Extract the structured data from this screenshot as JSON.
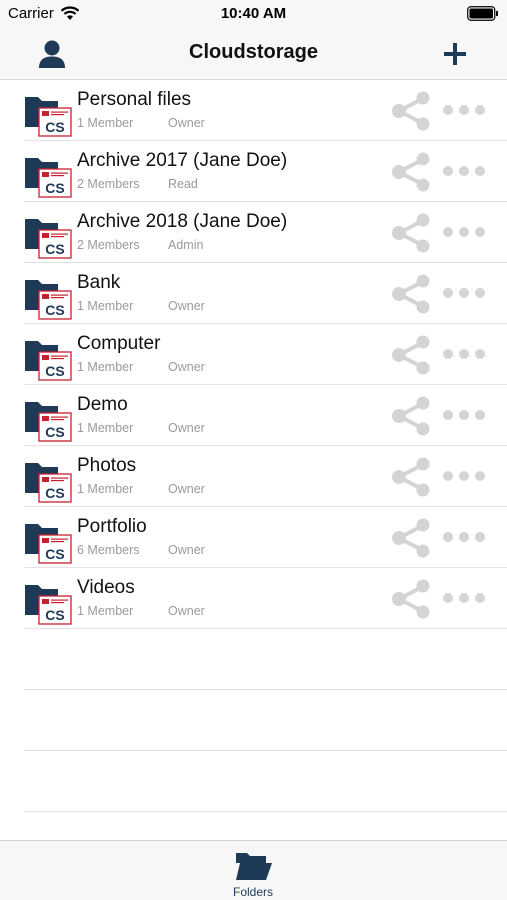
{
  "status_bar": {
    "carrier": "Carrier",
    "time": "10:40 AM"
  },
  "nav": {
    "title": "Cloudstorage",
    "left_icon": "user-icon",
    "right_icon": "plus-icon"
  },
  "colors": {
    "brand_navy": "#1e3a56",
    "badge_red": "#c8202f",
    "muted_icon": "#d4d4d4",
    "secondary_text": "#9a9a9a"
  },
  "folder_badge_text": "CS",
  "folders": [
    {
      "name": "Personal files",
      "members": "1 Member",
      "role": "Owner"
    },
    {
      "name": "Archive 2017 (Jane Doe)",
      "members": "2 Members",
      "role": "Read"
    },
    {
      "name": "Archive 2018 (Jane Doe)",
      "members": "2 Members",
      "role": "Admin"
    },
    {
      "name": "Bank",
      "members": "1 Member",
      "role": "Owner"
    },
    {
      "name": "Computer",
      "members": "1 Member",
      "role": "Owner"
    },
    {
      "name": "Demo",
      "members": "1 Member",
      "role": "Owner"
    },
    {
      "name": "Photos",
      "members": "1 Member",
      "role": "Owner"
    },
    {
      "name": "Portfolio",
      "members": "6 Members",
      "role": "Owner"
    },
    {
      "name": "Videos",
      "members": "1 Member",
      "role": "Owner"
    }
  ],
  "tab_bar": {
    "tabs": [
      {
        "label": "Folders",
        "icon": "folder-open-icon",
        "selected": true
      }
    ]
  }
}
